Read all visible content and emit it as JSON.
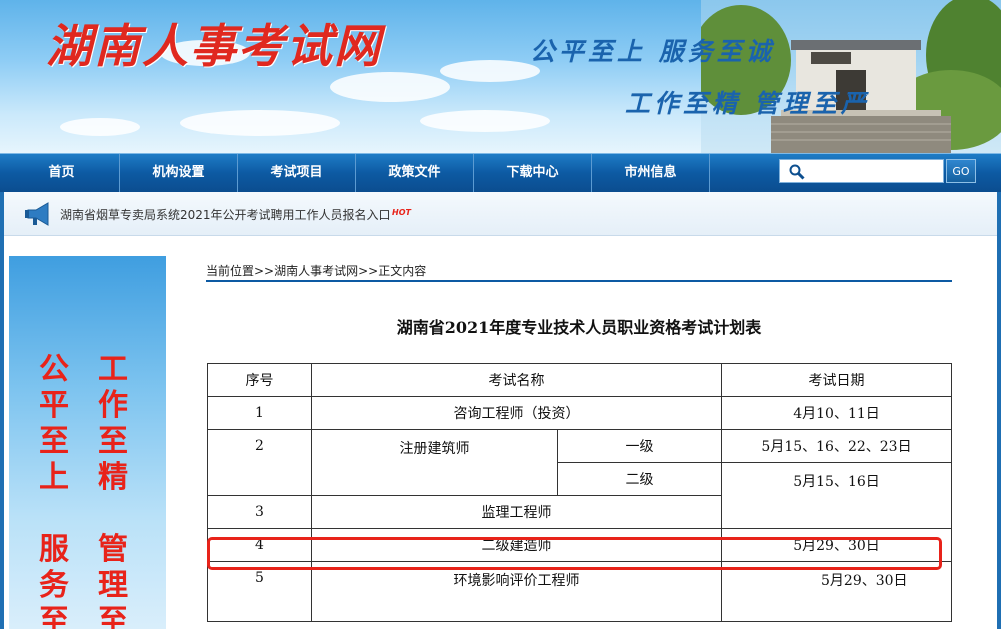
{
  "banner": {
    "site_title": "湖南人事考试网",
    "slogan_line1": "公平至上 服务至诚",
    "slogan_line2": "工作至精 管理至严"
  },
  "nav": {
    "items": [
      "首页",
      "机构设置",
      "考试项目",
      "政策文件",
      "下载中心",
      "市州信息"
    ],
    "search_placeholder": "",
    "go_label": "GO"
  },
  "notice": {
    "text": "湖南省烟草专卖局系统2021年公开考试聘用工作人员报名入口",
    "badge": "HOT"
  },
  "side": {
    "col1": [
      "公",
      "平",
      "至",
      "上",
      "",
      "服",
      "务",
      "至"
    ],
    "col2": [
      "工",
      "作",
      "至",
      "精",
      "",
      "管",
      "理",
      "至"
    ]
  },
  "breadcrumb": {
    "text": "当前位置>>湖南人事考试网>>正文内容"
  },
  "article": {
    "title": "湖南省2021年度专业技术人员职业资格考试计划表",
    "table": {
      "headers": [
        "序号",
        "考试名称",
        "考试日期"
      ],
      "rows": [
        {
          "no": "1",
          "name": "咨询工程师（投资）",
          "date": "4月10、11日"
        },
        {
          "no": "2",
          "name": "注册建筑师",
          "levels": [
            {
              "level": "一级",
              "date": "5月15、16、22、23日"
            },
            {
              "level": "二级",
              "date": "5月15、16日"
            }
          ]
        },
        {
          "no": "3",
          "name": "监理工程师",
          "date": ""
        },
        {
          "no": "4",
          "name": "二级建造师",
          "date": "5月29、30日"
        },
        {
          "no": "5",
          "name": "环境影响评价工程师",
          "date": "5月29、30日"
        }
      ]
    }
  },
  "colors": {
    "nav_blue": "#0d5aa3",
    "highlight_red": "#e8231a",
    "title_red": "#e0281f"
  }
}
